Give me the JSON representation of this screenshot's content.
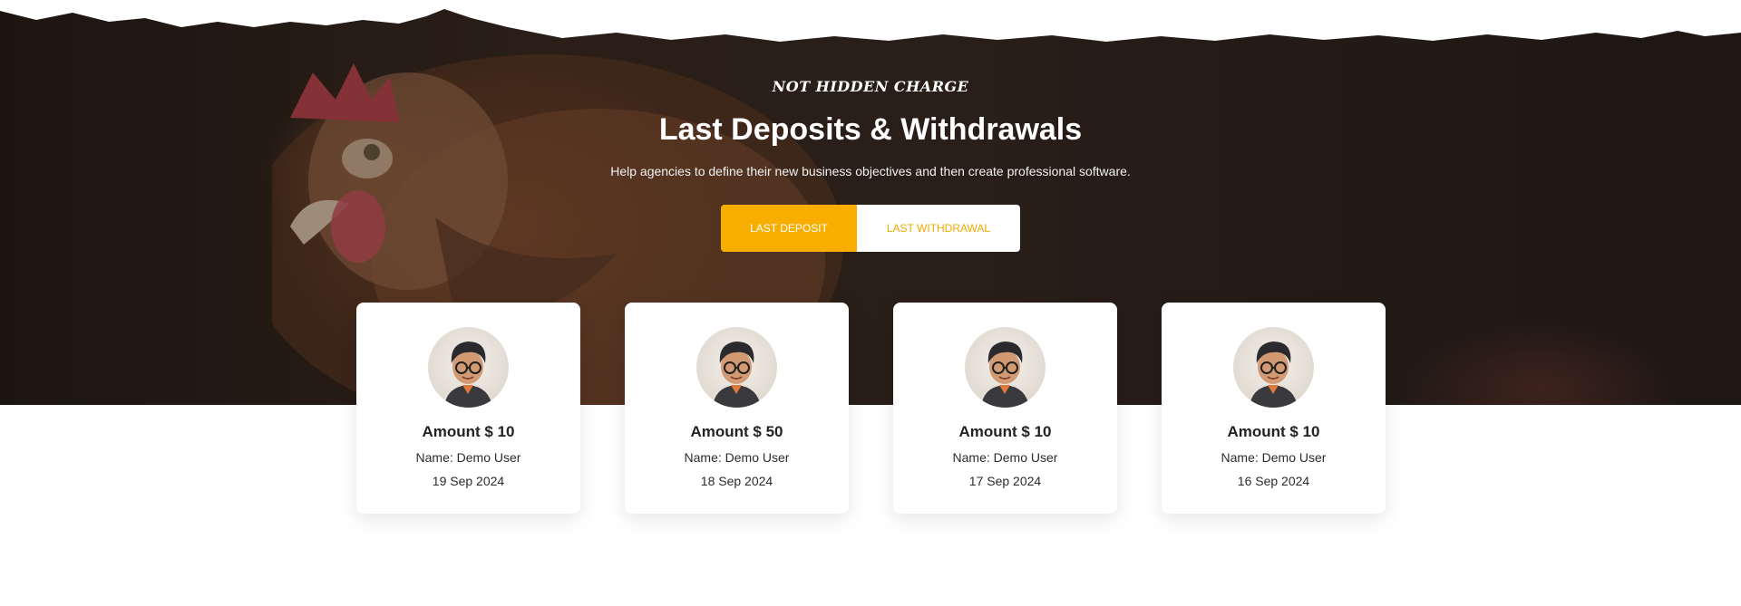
{
  "section": {
    "eyebrow": "NOT HIDDEN CHARGE",
    "title": "Last Deposits & Withdrawals",
    "subtitle": "Help agencies to define their new business objectives and then create professional software."
  },
  "tabs": [
    {
      "label": "LAST DEPOSIT",
      "active": true
    },
    {
      "label": "LAST WITHDRAWAL",
      "active": false
    }
  ],
  "colors": {
    "accent": "#f8ae00",
    "hero_bg": "#3a2a22"
  },
  "cards": [
    {
      "amount": "Amount $ 10",
      "name": "Name: Demo User",
      "date": "19 Sep 2024",
      "avatar_icon": "avatar-icon"
    },
    {
      "amount": "Amount $ 50",
      "name": "Name: Demo User",
      "date": "18 Sep 2024",
      "avatar_icon": "avatar-icon"
    },
    {
      "amount": "Amount $ 10",
      "name": "Name: Demo User",
      "date": "17 Sep 2024",
      "avatar_icon": "avatar-icon"
    },
    {
      "amount": "Amount $ 10",
      "name": "Name: Demo User",
      "date": "16 Sep 2024",
      "avatar_icon": "avatar-icon"
    }
  ]
}
